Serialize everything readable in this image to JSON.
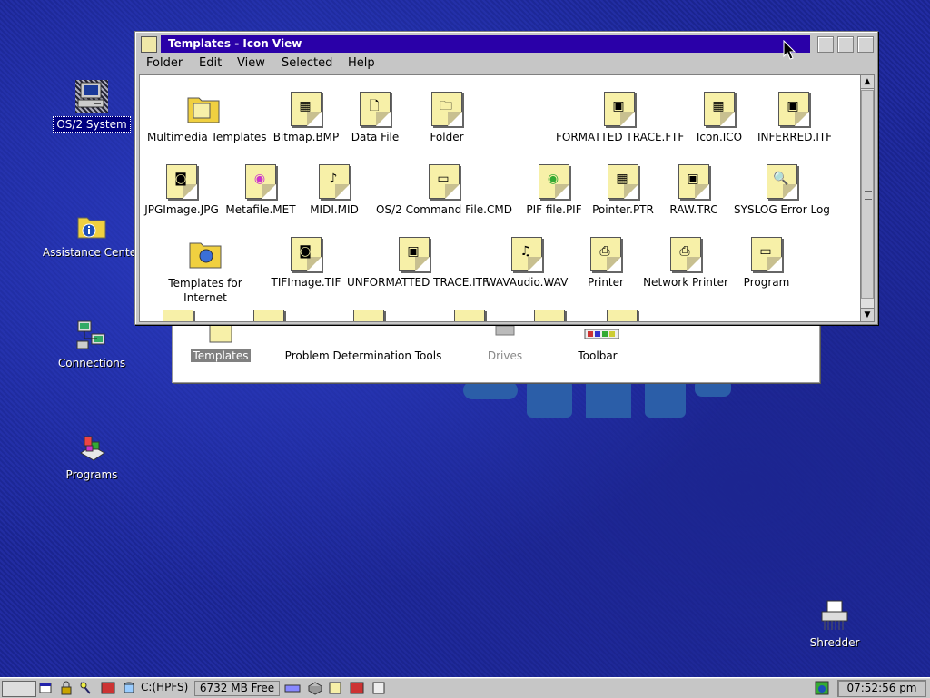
{
  "desktop": {
    "icons": [
      {
        "label": "OS/2 System"
      },
      {
        "label": "Assistance Center"
      },
      {
        "label": "Connections"
      },
      {
        "label": "Programs"
      },
      {
        "label": "Shredder"
      }
    ]
  },
  "background_window": {
    "icons": [
      "Templates",
      "Problem Determination Tools",
      "Drives",
      "Toolbar"
    ]
  },
  "window": {
    "title": "Templates - Icon View",
    "menu": [
      "Folder",
      "Edit",
      "View",
      "Selected",
      "Help"
    ],
    "templates": [
      "Multimedia Templates",
      "Bitmap.BMP",
      "Data File",
      "Folder",
      "FORMATTED TRACE.FTF",
      "Icon.ICO",
      "INFERRED.ITF",
      "JPGImage.JPG",
      "Metafile.MET",
      "MIDI.MID",
      "OS/2 Command File.CMD",
      "PIF file.PIF",
      "Pointer.PTR",
      "RAW.TRC",
      "SYSLOG Error Log",
      "Templates for Internet",
      "TIFImage.TIF",
      "UNFORMATTED TRACE.ITF",
      "WAVAudio.WAV",
      "Printer",
      "Network Printer",
      "Program"
    ]
  },
  "taskbar": {
    "drive": "C:(HPFS)",
    "free": "6732 MB Free",
    "time": "07:52:56 pm"
  },
  "colors": {
    "desktop": "#1f2a9e",
    "titlebar": "#2a00a8",
    "template_page": "#f7f0a8"
  }
}
